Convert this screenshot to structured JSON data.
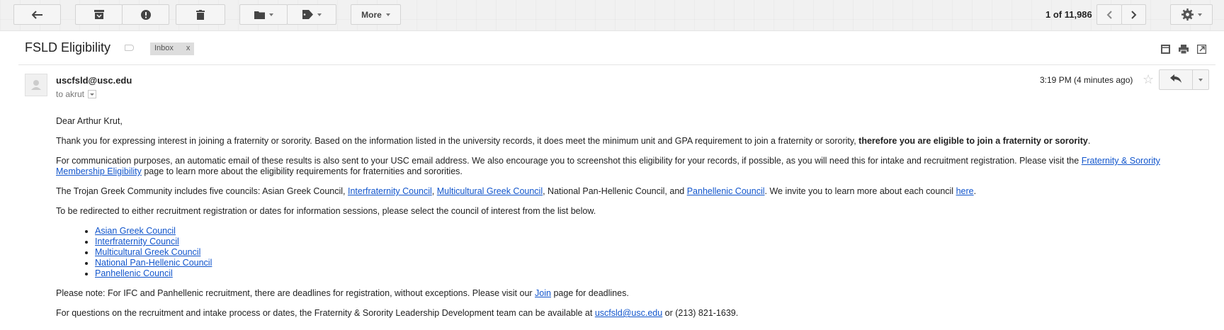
{
  "toolbar": {
    "back_icon": "arrow-left-icon",
    "archive_icon": "archive-icon",
    "spam_icon": "report-spam-icon",
    "delete_icon": "trash-icon",
    "move_icon": "folder-icon",
    "labels_icon": "tag-icon",
    "more_label": "More",
    "pager_text": "1 of 11,986",
    "settings_icon": "gear-icon"
  },
  "message": {
    "subject": "FSLD Eligibility",
    "label_chip": "Inbox",
    "label_chip_close": "x",
    "sender": "uscfsld@usc.edu",
    "to_text": "to akrut",
    "timestamp": "3:19 PM (4 minutes ago)",
    "star": "☆"
  },
  "body": {
    "greeting": "Dear Arthur Krut,",
    "p1_text": "Thank you for expressing interest in joining a fraternity or sorority. Based on the information listed in the university records, it does meet the minimum unit and GPA requirement to join a fraternity or sorority, ",
    "p1_bold": "therefore you are eligible to join a fraternity or sorority",
    "p1_end": ".",
    "p2_text": "For communication purposes, an automatic email of these results is also sent to your USC email address. We also encourage you to screenshot this eligibility for your records, if possible, as you will need this for intake and recruitment registration. Please visit the ",
    "p2_link": "Fraternity & Sorority Membership Eligibility",
    "p2_end": " page to learn more about the eligibility requirements for fraternities and sororities.",
    "p3_text": "The Trojan Greek Community includes five councils: Asian Greek Council, ",
    "p3_link1": "Interfraternity Council",
    "p3_sep1": ", ",
    "p3_link2": "Multicultural Greek Council",
    "p3_mid": ", National Pan-Hellenic Council, and ",
    "p3_link3": "Panhellenic Council",
    "p3_mid2": ". We invite you to learn more about each council ",
    "p3_link4": "here",
    "p3_end": ".",
    "p4_text": "To be redirected to either recruitment registration or dates for information sessions, please select the council of interest from the list below.",
    "council_links": [
      "Asian Greek Council",
      "Interfraternity Council",
      "Multicultural Greek Council",
      "National Pan-Hellenic Council",
      "Panhellenic Council"
    ],
    "p5_text": "Please note: For IFC and Panhellenic recruitment, there are deadlines for registration, without exceptions. Please visit our ",
    "p5_link": "Join",
    "p5_end": " page for deadlines.",
    "p6_text": "For questions on the recruitment and intake process or dates, the Fraternity & Sorority Leadership Development team can be available at ",
    "p6_link": "uscfsld@usc.edu",
    "p6_end": " or (213) 821-1639."
  },
  "colors": {
    "link": "#1155cc",
    "toolbar_bg": "#f1f1f1",
    "button_bg": "#f5f5f5"
  }
}
